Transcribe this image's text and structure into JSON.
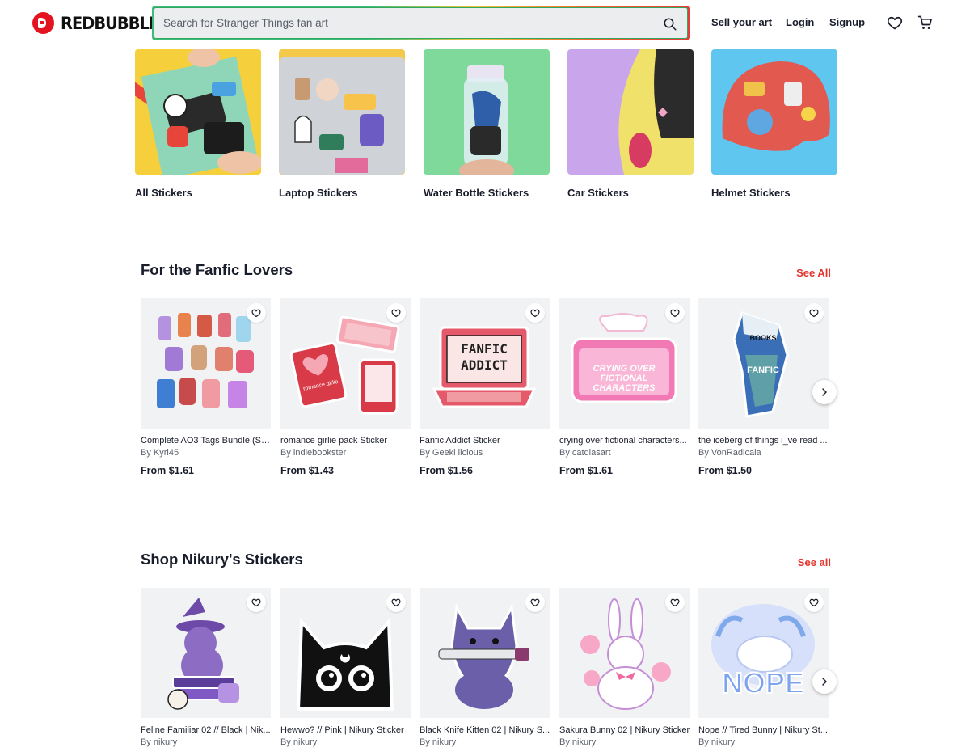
{
  "header": {
    "brand": "REDBUBBLE",
    "search_placeholder": "Search for Stranger Things fan art",
    "sell_label": "Sell your art",
    "login_label": "Login",
    "signup_label": "Signup"
  },
  "categories": [
    {
      "label": "All Stickers"
    },
    {
      "label": "Laptop Stickers"
    },
    {
      "label": "Water Bottle Stickers"
    },
    {
      "label": "Car Stickers"
    },
    {
      "label": "Helmet Stickers"
    }
  ],
  "sections": [
    {
      "title": "For the Fanfic Lovers",
      "see_all": "See All",
      "products": [
        {
          "title": "Complete AO3 Tags Bundle (SE...",
          "artist": "By Kyri45",
          "price": "From $1.61"
        },
        {
          "title": "romance girlie pack Sticker",
          "artist": "By indiebookster",
          "price": "From $1.43"
        },
        {
          "title": "Fanfic Addict Sticker",
          "artist": "By Geeki licious",
          "price": "From $1.56"
        },
        {
          "title": "crying over fictional characters...",
          "artist": "By catdiasart",
          "price": "From $1.61"
        },
        {
          "title": "the iceberg of things i_ve read ...",
          "artist": "By VonRadicala",
          "price": "From $1.50"
        }
      ]
    },
    {
      "title": "Shop Nikury's Stickers",
      "see_all": "See all",
      "products": [
        {
          "title": "Feline Familiar 02 // Black | Nik...",
          "artist": "By nikury"
        },
        {
          "title": "Hewwo? // Pink | Nikury Sticker",
          "artist": "By nikury"
        },
        {
          "title": "Black Knife Kitten 02 | Nikury S...",
          "artist": "By nikury"
        },
        {
          "title": "Sakura Bunny 02 | Nikury Sticker",
          "artist": "By nikury"
        },
        {
          "title": "Nope // Tired Bunny | Nikury St...",
          "artist": "By nikury"
        }
      ]
    }
  ],
  "artwork_text": {
    "fanfic_addict": "FANFIC ADDICT",
    "crying_over": "CRYING OVER FICTIONAL CHARACTERS",
    "iceberg_books": "BOOKS",
    "iceberg_fanfic": "FANFIC",
    "nope": "NOPE",
    "romance": "romance girlie"
  },
  "colors": {
    "brand_red": "#e41321",
    "accent_link": "#e4342d",
    "text": "#191d2b"
  }
}
